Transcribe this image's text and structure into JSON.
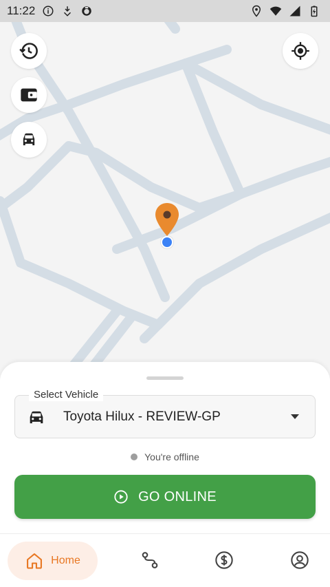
{
  "status_bar": {
    "time": "11:22",
    "left_icons": [
      "info-circle-icon",
      "download-shield-icon",
      "app-face-icon"
    ],
    "right_icons": [
      "location-icon",
      "wifi-icon",
      "signal-icon",
      "battery-icon"
    ]
  },
  "map": {
    "buttons": [
      {
        "name": "history-icon"
      },
      {
        "name": "wallet-icon"
      },
      {
        "name": "car-icon"
      },
      {
        "name": "my-location-icon"
      }
    ],
    "road_color": "#cfd9e3",
    "pin_color": "#e98a2e",
    "location_dot_color": "#3b82f6"
  },
  "sheet": {
    "vehicle_label": "Select Vehicle",
    "vehicle_value": "Toyota Hilux - REVIEW-GP",
    "status_text": "You're offline",
    "go_online_label": "GO ONLINE",
    "go_online_color": "#43a047"
  },
  "nav": {
    "items": [
      {
        "label": "Home",
        "icon": "home-icon",
        "active": true
      },
      {
        "label": "",
        "icon": "route-icon",
        "active": false
      },
      {
        "label": "",
        "icon": "dollar-icon",
        "active": false
      },
      {
        "label": "",
        "icon": "profile-icon",
        "active": false
      }
    ],
    "active_color": "#e87722"
  }
}
